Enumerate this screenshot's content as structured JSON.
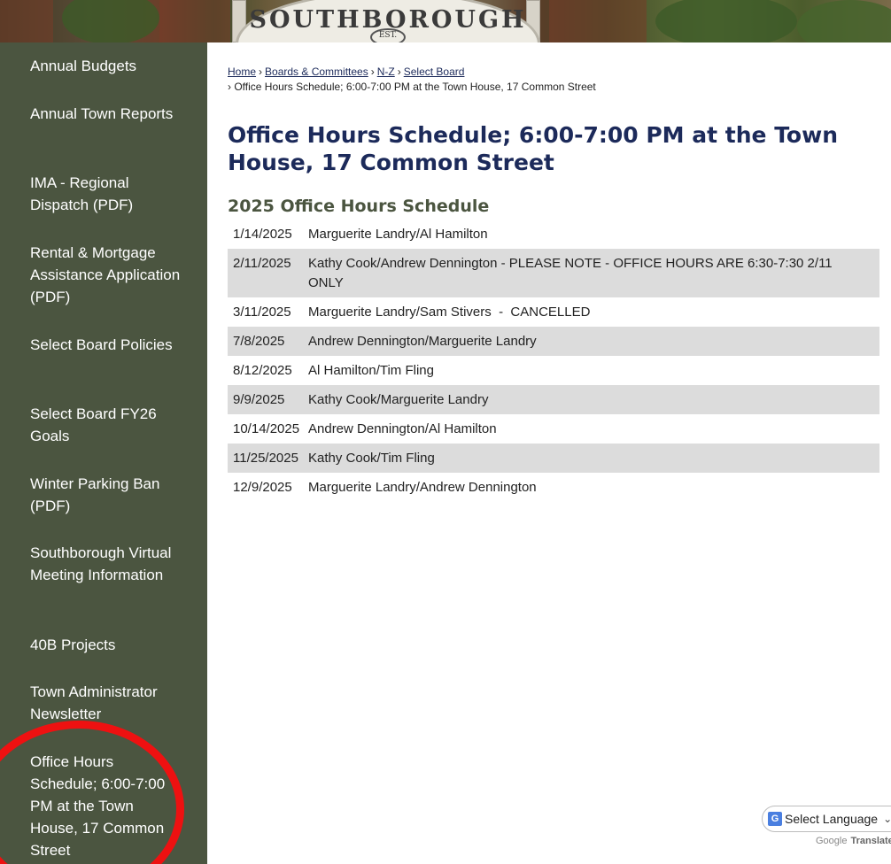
{
  "header": {
    "sign_text": "SOUTHBOROUGH",
    "sign_est": "EST."
  },
  "sidebar": {
    "items": [
      {
        "label": "Annual Budgets"
      },
      {
        "label": "Annual Town Reports"
      },
      {
        "label": "IMA - Regional Dispatch (PDF)"
      },
      {
        "label": "Rental & Mortgage Assistance Application (PDF)"
      },
      {
        "label": "Select Board Policies"
      },
      {
        "label": "Select Board FY26 Goals"
      },
      {
        "label": "Winter Parking Ban (PDF)"
      },
      {
        "label": "Southborough Virtual Meeting Information"
      },
      {
        "label": "40B Projects"
      },
      {
        "label": "Town Administrator Newsletter"
      },
      {
        "label": "Office Hours Schedule; 6:00-7:00 PM at the Town House, 17 Common Street"
      }
    ]
  },
  "breadcrumb": {
    "home": "Home",
    "boards": "Boards & Committees",
    "nz": "N-Z",
    "select_board": "Select Board",
    "sep": "›",
    "current": "› Office Hours Schedule; 6:00-7:00 PM at the Town House, 17 Common Street"
  },
  "page": {
    "title": "Office Hours Schedule; 6:00-7:00 PM at the Town House, 17 Common Street",
    "section_title": "2025 Office Hours Schedule"
  },
  "schedule": [
    {
      "date": "1/14/2025",
      "names": "Marguerite Landry/Al Hamilton"
    },
    {
      "date": "2/11/2025",
      "names": "Kathy Cook/Andrew Dennington - PLEASE NOTE - OFFICE HOURS ARE 6:30-7:30 2/11 ONLY"
    },
    {
      "date": "3/11/2025",
      "names": "Marguerite Landry/Sam Stivers  -  CANCELLED"
    },
    {
      "date": "7/8/2025",
      "names": "Andrew Dennington/Marguerite Landry"
    },
    {
      "date": "8/12/2025",
      "names": "Al Hamilton/Tim Fling"
    },
    {
      "date": "9/9/2025",
      "names": "Kathy Cook/Marguerite Landry"
    },
    {
      "date": "10/14/2025",
      "names": "Andrew Dennington/Al Hamilton"
    },
    {
      "date": "11/25/2025",
      "names": "Kathy Cook/Tim Fling"
    },
    {
      "date": "12/9/2025",
      "names": "Marguerite Landry/Andrew Dennington"
    }
  ],
  "translate": {
    "select_label": "Select Language",
    "powered_google": "Google",
    "powered_translate": "Translate"
  },
  "colors": {
    "sidebar_bg": "#4b5540",
    "title_color": "#1c2a5a",
    "row_alt_bg": "#dcdcdc",
    "highlight_circle": "#ee1111"
  }
}
